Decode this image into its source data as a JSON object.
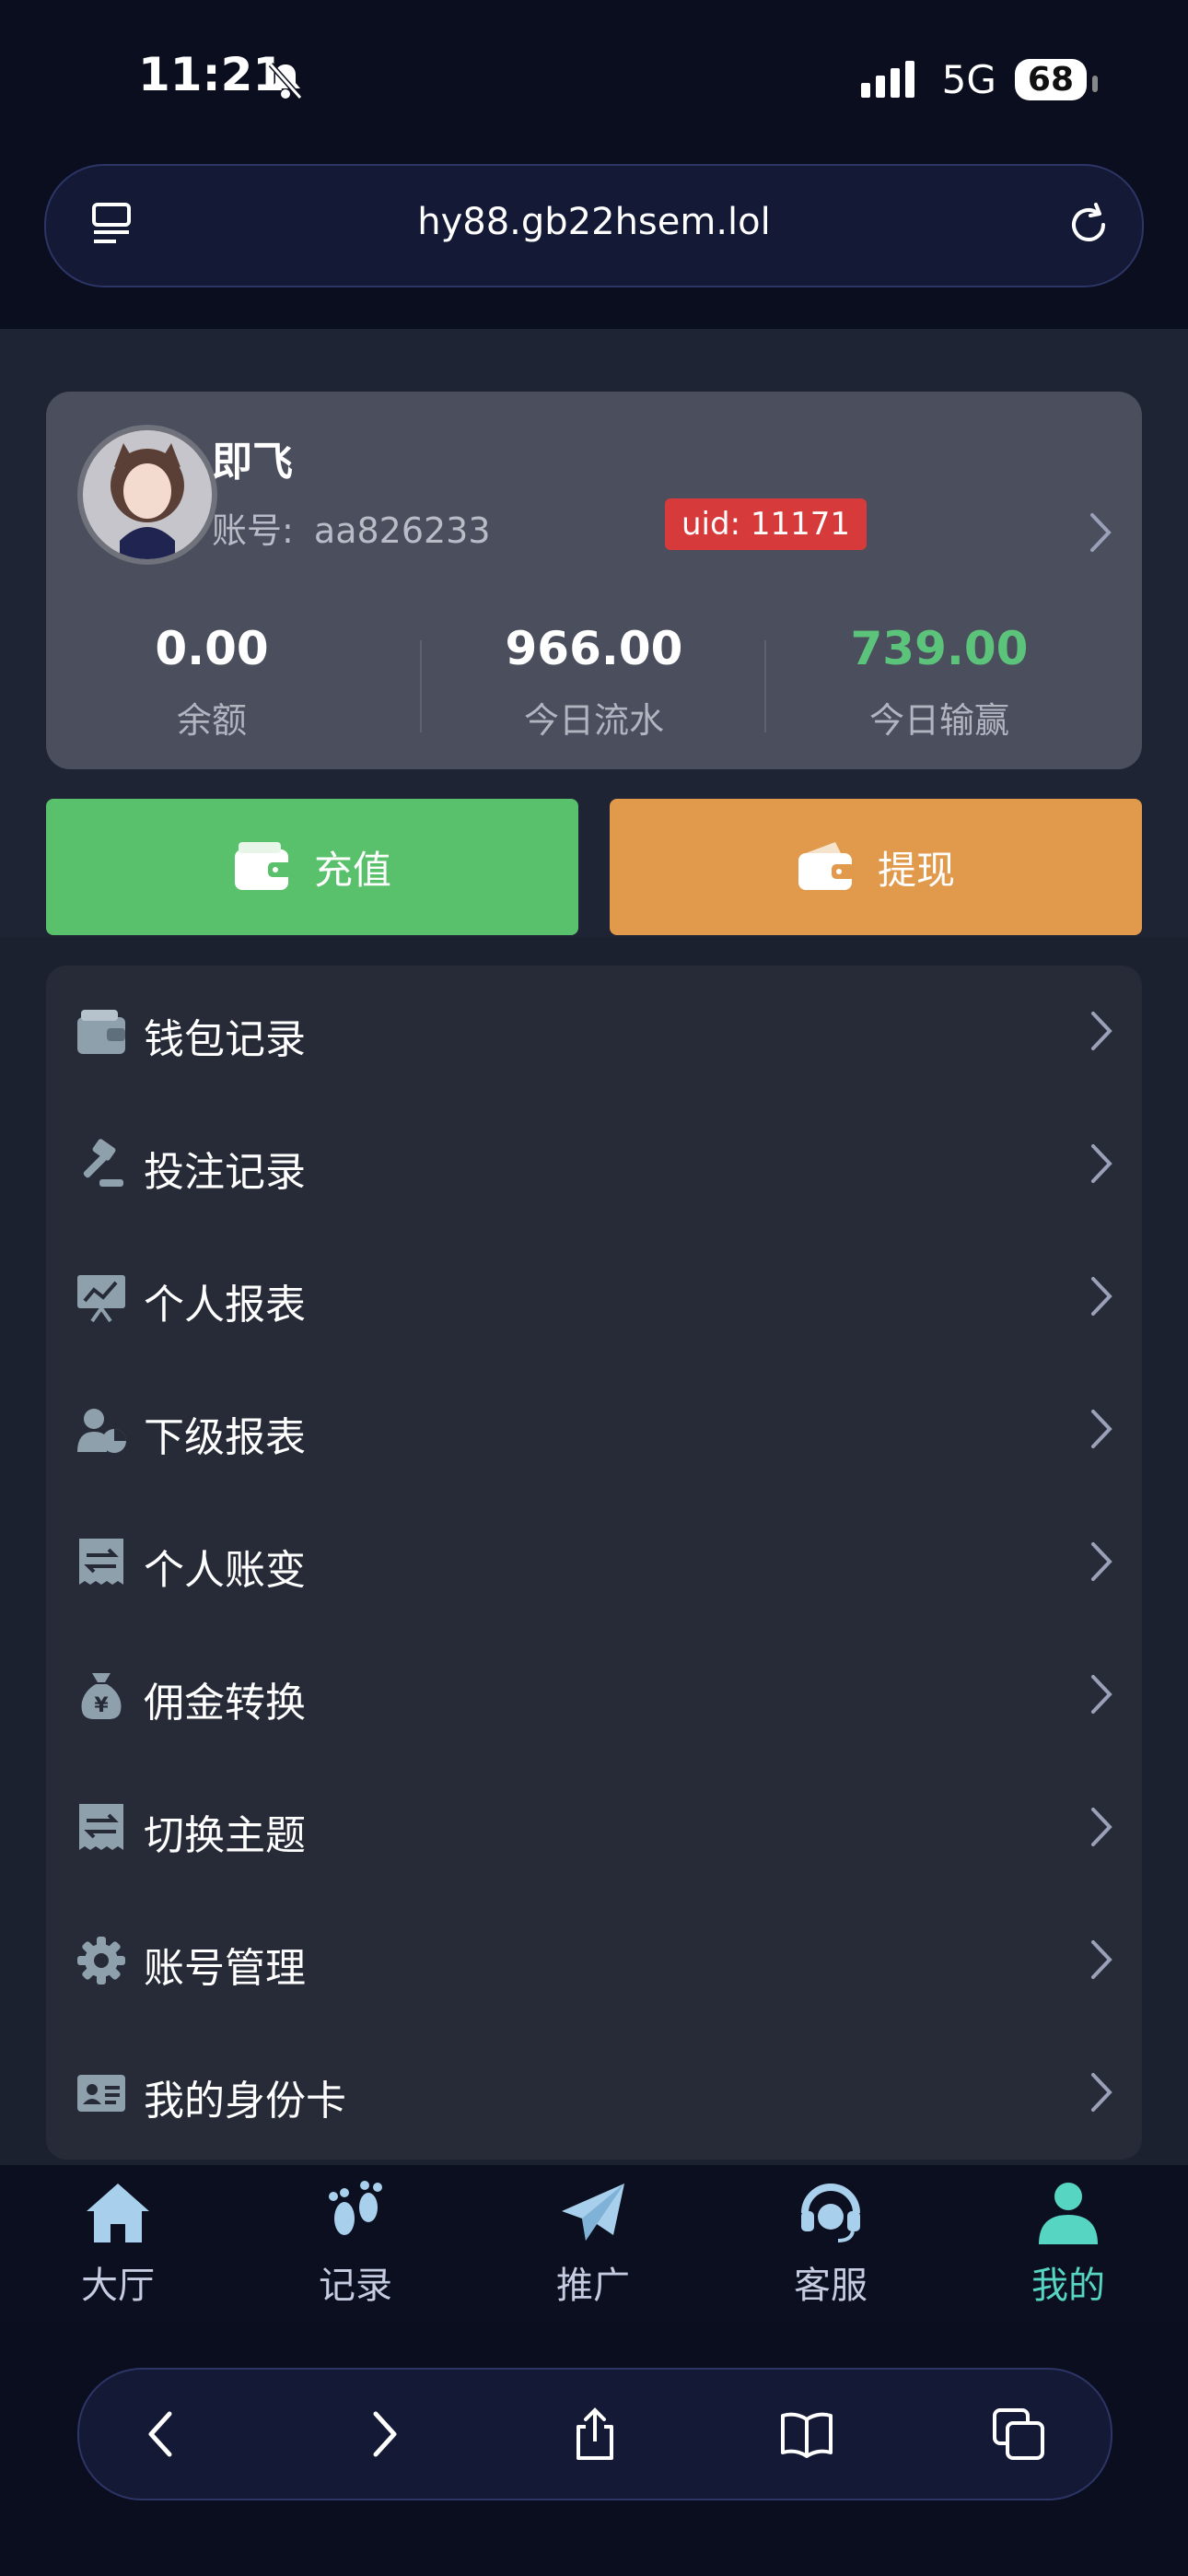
{
  "status": {
    "time": "11:21",
    "network": "5G",
    "battery": "68"
  },
  "browser": {
    "url": "hy88.gb22hsem.lol"
  },
  "profile": {
    "name": "即飞",
    "account_label": "账号:",
    "account": "aa826233",
    "uid": "uid: 11171",
    "stats": [
      {
        "value": "0.00",
        "label": "余额",
        "color": "#ffffff"
      },
      {
        "value": "966.00",
        "label": "今日流水",
        "color": "#ffffff"
      },
      {
        "value": "739.00",
        "label": "今日输赢",
        "color": "#5cc47a"
      }
    ]
  },
  "actions": {
    "deposit": "充值",
    "withdraw": "提现"
  },
  "menu": [
    {
      "label": "钱包记录",
      "icon": "wallet-icon"
    },
    {
      "label": "投注记录",
      "icon": "gavel-icon"
    },
    {
      "label": "个人报表",
      "icon": "chart-board-icon"
    },
    {
      "label": "下级报表",
      "icon": "user-pie-icon"
    },
    {
      "label": "个人账变",
      "icon": "receipt-exchange-icon"
    },
    {
      "label": "佣金转换",
      "icon": "money-bag-icon"
    },
    {
      "label": "切换主题",
      "icon": "receipt-exchange-icon"
    },
    {
      "label": "账号管理",
      "icon": "gear-icon"
    },
    {
      "label": "我的身份卡",
      "icon": "id-card-icon"
    }
  ],
  "tabs": [
    {
      "label": "大厅",
      "icon": "home-icon"
    },
    {
      "label": "记录",
      "icon": "footprints-icon"
    },
    {
      "label": "推广",
      "icon": "paper-plane-icon"
    },
    {
      "label": "客服",
      "icon": "headset-icon"
    },
    {
      "label": "我的",
      "icon": "user-icon",
      "active": true
    }
  ],
  "colors": {
    "accent": "#56d6c2",
    "deposit": "#59c06b",
    "withdraw": "#e1994c",
    "uid_badge": "#d63a3a"
  }
}
